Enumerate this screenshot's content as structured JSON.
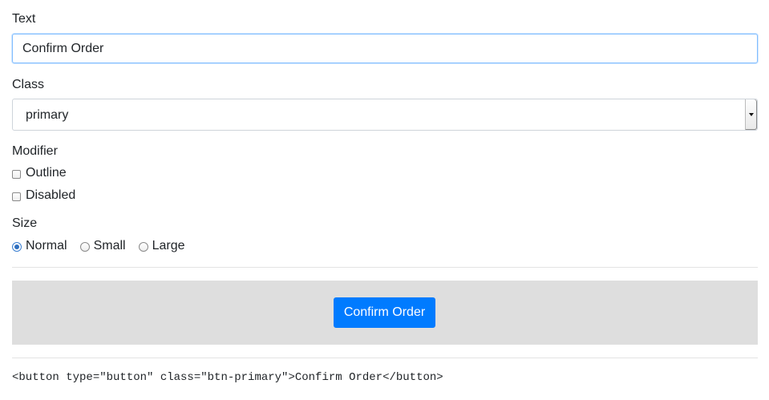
{
  "form": {
    "text_label": "Text",
    "text_value": "Confirm Order",
    "class_label": "Class",
    "class_value": "primary",
    "modifier_label": "Modifier",
    "modifiers": [
      {
        "label": "Outline",
        "checked": false
      },
      {
        "label": "Disabled",
        "checked": false
      }
    ],
    "size_label": "Size",
    "sizes": [
      {
        "label": "Normal",
        "checked": true
      },
      {
        "label": "Small",
        "checked": false
      },
      {
        "label": "Large",
        "checked": false
      }
    ]
  },
  "preview": {
    "button_label": "Confirm Order",
    "button_color": "#007bff",
    "background": "#dedede"
  },
  "code": {
    "snippet": "<button type=\"button\" class=\"btn-primary\">Confirm Order</button>"
  }
}
